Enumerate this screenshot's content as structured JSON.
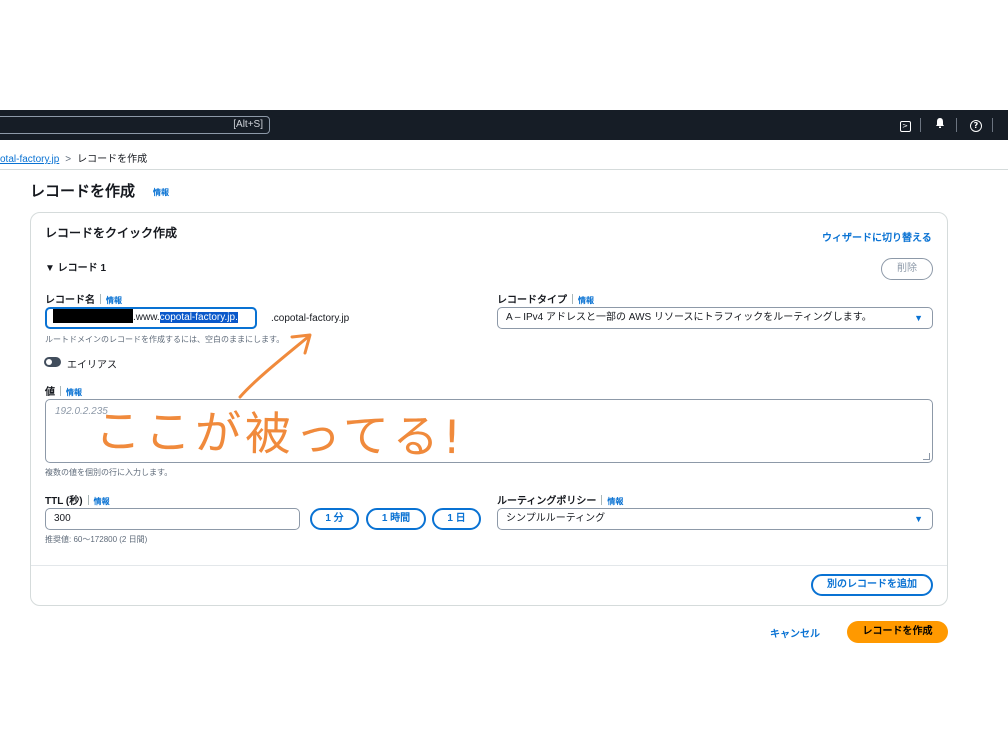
{
  "topbar": {
    "search_shortcut": "[Alt+S]",
    "icons": [
      "terminal-icon",
      "bell-icon",
      "help-icon"
    ]
  },
  "breadcrumb": {
    "parent": "otal-factory.jp",
    "separator": ">",
    "current": "レコードを作成"
  },
  "page": {
    "title": "レコードを作成",
    "info": "情報"
  },
  "panel": {
    "title": "レコードをクイック作成",
    "wizard_link": "ウィザードに切り替える",
    "record_header": "▼ レコード 1",
    "delete_button": "削除",
    "record_name": {
      "label": "レコード名",
      "info": "情報",
      "value_prefix": ".www.",
      "value_selected": "copotal-factory.jp.",
      "domain_suffix": ".copotal-factory.jp",
      "hint": "ルートドメインのレコードを作成するには、空白のままにします。"
    },
    "record_type": {
      "label": "レコードタイプ",
      "info": "情報",
      "value": "A – IPv4 アドレスと一部の AWS リソースにトラフィックをルーティングします。"
    },
    "alias": {
      "label": "エイリアス",
      "enabled": false
    },
    "value": {
      "label": "値",
      "info": "情報",
      "placeholder": "192.0.2.235",
      "hint": "複数の値を個別の行に入力します。"
    },
    "ttl": {
      "label": "TTL (秒)",
      "info": "情報",
      "value": "300",
      "presets": [
        "1 分",
        "1 時間",
        "1 日"
      ],
      "hint": "推奨値: 60～172800 (2 日間)"
    },
    "routing_policy": {
      "label": "ルーティングポリシー",
      "info": "情報",
      "value": "シンプルルーティング"
    },
    "add_record_button": "別のレコードを追加"
  },
  "footer": {
    "cancel": "キャンセル",
    "create": "レコードを作成"
  },
  "annotation": {
    "text": "ここが被ってる!",
    "color": "#f08a3c"
  },
  "colors": {
    "accent": "#0972d3",
    "primary_button": "#ff9900",
    "topbar": "#161d26"
  }
}
